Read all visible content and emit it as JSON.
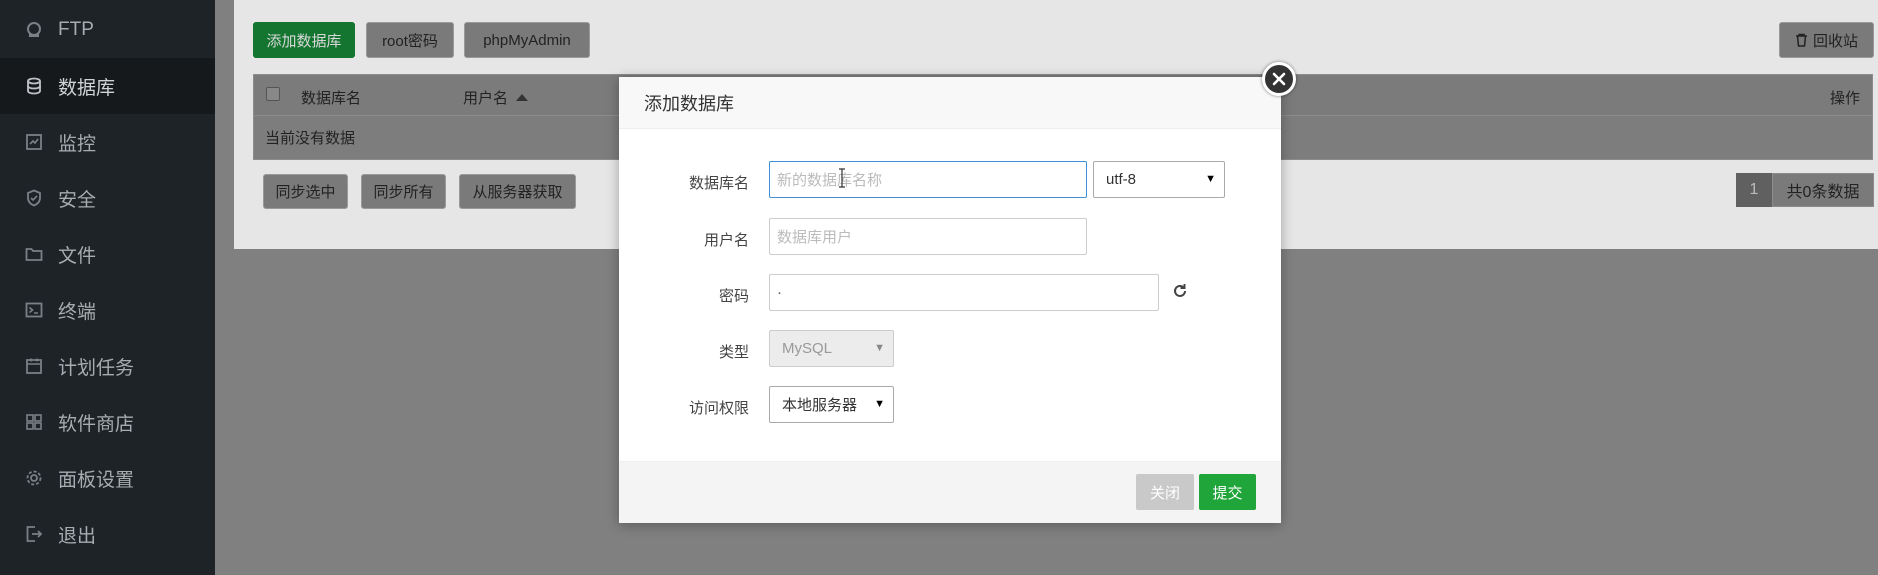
{
  "sidebar": {
    "items": [
      {
        "label": "FTP",
        "icon": "ftp-icon"
      },
      {
        "label": "数据库",
        "icon": "database-icon",
        "active": true
      },
      {
        "label": "监控",
        "icon": "monitor-icon"
      },
      {
        "label": "安全",
        "icon": "shield-icon"
      },
      {
        "label": "文件",
        "icon": "folder-icon"
      },
      {
        "label": "终端",
        "icon": "terminal-icon"
      },
      {
        "label": "计划任务",
        "icon": "calendar-icon"
      },
      {
        "label": "软件商店",
        "icon": "grid-icon"
      },
      {
        "label": "面板设置",
        "icon": "gear-icon"
      },
      {
        "label": "退出",
        "icon": "logout-icon"
      }
    ]
  },
  "toolbar": {
    "add_db": "添加数据库",
    "root_pw": "root密码",
    "phpmyadmin": "phpMyAdmin",
    "recycle": "回收站"
  },
  "table": {
    "col_name": "数据库名",
    "col_user": "用户名",
    "col_ops": "操作",
    "empty": "当前没有数据"
  },
  "bottom_actions": {
    "sync_selected": "同步选中",
    "sync_all": "同步所有",
    "fetch_server": "从服务器获取"
  },
  "pager": {
    "page": "1",
    "total": "共0条数据"
  },
  "modal": {
    "title": "添加数据库",
    "fields": {
      "db_name_label": "数据库名",
      "db_name_placeholder": "新的数据库名称",
      "charset": "utf-8",
      "user_label": "用户名",
      "user_placeholder": "数据库用户",
      "password_label": "密码",
      "password_value": "·",
      "type_label": "类型",
      "type_value": "MySQL",
      "access_label": "访问权限",
      "access_value": "本地服务器"
    },
    "close_btn": "关闭",
    "submit_btn": "提交"
  },
  "colors": {
    "accent_green": "#20a53a",
    "sidebar_bg": "#2f3a43",
    "focus_blue": "#3f8fd2"
  }
}
